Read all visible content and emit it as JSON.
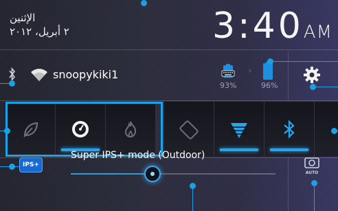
{
  "header": {
    "day": "الإثنين",
    "date": "٢ أبريل، ٢٠١٢",
    "time": "3:40",
    "ampm": "AM"
  },
  "connection": {
    "bluetooth_icon": "bluetooth-icon",
    "wifi_icon": "wifi-icon",
    "ssid": "snoopykiki1"
  },
  "battery": {
    "dock_percent": "93%",
    "tablet_percent": "96%",
    "dock_level": 0.93,
    "tablet_level": 0.96
  },
  "settings_icon": "gear-icon",
  "toggles": [
    {
      "name": "power-saving-mode",
      "icon": "leaf-icon",
      "active": false
    },
    {
      "name": "balanced-mode",
      "icon": "gauge-icon",
      "active": true
    },
    {
      "name": "performance-mode",
      "icon": "flame-icon",
      "active": false
    },
    {
      "name": "auto-rotate",
      "icon": "rotate-icon",
      "active": false
    },
    {
      "name": "wifi",
      "icon": "wifi-icon",
      "active": true
    },
    {
      "name": "bluetooth",
      "icon": "bluetooth-icon",
      "active": true
    }
  ],
  "display": {
    "ips_badge": "IPS+",
    "mode_label": "Super IPS+ mode (Outdoor)",
    "brightness_level": 0.4,
    "auto_icon": "auto-brightness-icon",
    "auto_label": "AUTO"
  },
  "colors": {
    "accent": "#1ba0e6",
    "selection": "#19a3e8"
  }
}
